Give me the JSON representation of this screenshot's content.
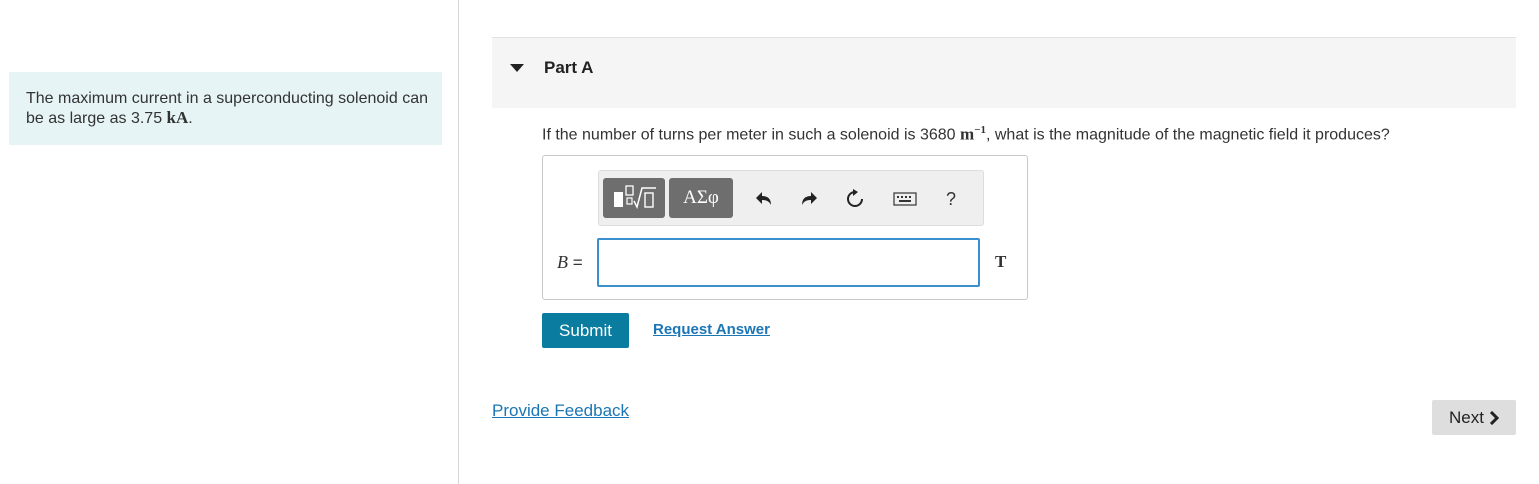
{
  "intro": {
    "text_before": "The maximum current in a superconducting solenoid can be as large as 3.75 ",
    "unit": "kA",
    "text_after": "."
  },
  "part": {
    "title": "Part A",
    "question_before": "If the number of turns per meter in such a solenoid is 3680 ",
    "question_unit": "m",
    "question_exponent": "−1",
    "question_after": ", what is the magnitude of the magnetic field it produces?"
  },
  "toolbar": {
    "greek_label": "ΑΣφ",
    "help_label": "?",
    "icons": [
      "templates-icon",
      "undo-icon",
      "redo-icon",
      "reset-icon",
      "keyboard-icon",
      "help-icon"
    ]
  },
  "answer": {
    "variable": "B",
    "equals": "=",
    "value": "",
    "unit": "T"
  },
  "actions": {
    "submit_label": "Submit",
    "request_answer_label": "Request Answer",
    "feedback_label": "Provide Feedback",
    "next_label": "Next"
  },
  "colors": {
    "submit_bg": "#0a7ca0",
    "link": "#1a76b5",
    "intro_bg": "#e6f4f5",
    "input_border": "#3a8fcf"
  }
}
